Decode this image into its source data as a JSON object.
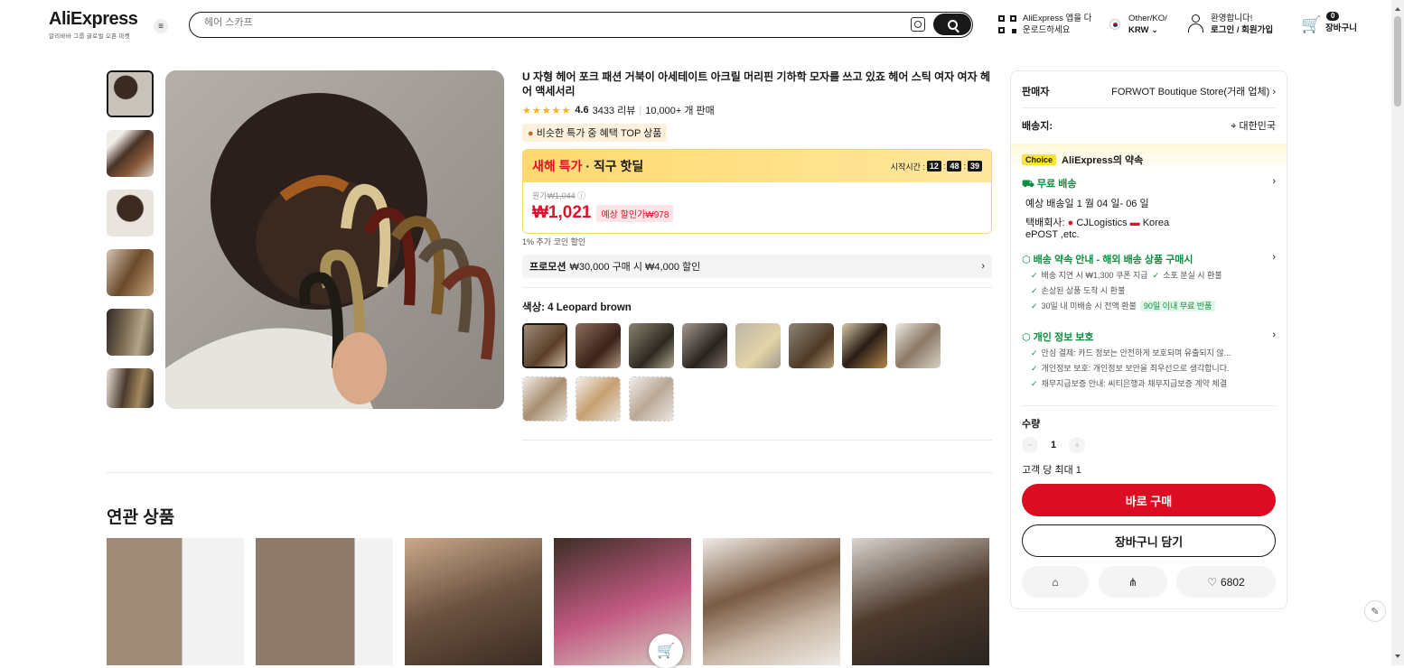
{
  "header": {
    "logo": "AliExpress",
    "logo_sub": "알리바바 그룹 글로벌 오픈 마켓",
    "search_placeholder": "헤어 스카프",
    "app_line1": "AliExpress 앱을 다",
    "app_line2": "운로드하세요",
    "region_line1": "Other/KO/",
    "region_line2": "KRW",
    "user_line1": "환영합니다!",
    "user_line2": "로그인 / 회원가입",
    "cart_count": "0",
    "cart_label": "장바구니"
  },
  "product": {
    "title": "U 자형 헤어 포크 패션 거북이 아세테이트 아크릴 머리핀 기하학 모자를 쓰고 있죠 헤어 스틱 여자 여자 헤어 액세서리",
    "stars": "★★★★★",
    "rating": "4.6",
    "reviews": "3433 리뷰",
    "sold": "10,000+ 개 판매",
    "top_badge": "비슷한 특가 중 혜택 TOP 상품",
    "deal_title": "새해 특가",
    "deal_sub": "· 직구 핫딜",
    "timer_label": "시작시간 :",
    "timer_h": "12",
    "timer_m": "48",
    "timer_s": "39",
    "orig_label": "원가",
    "orig_price": "₩1,044",
    "price": "₩1,021",
    "est_price": "예상 할인가₩978",
    "coin": "1% 추가 코인 할인",
    "promo_label": "프로모션",
    "promo_text": "₩30,000 구매 시 ₩4,000 할인",
    "color_label": "색상: 4 Leopard brown"
  },
  "related": {
    "title": "연관 상품"
  },
  "side": {
    "seller_label": "판매자",
    "seller_name": "FORWOT Boutique Store(거래 업체)",
    "ship_label": "배송지:",
    "ship_to": "대한민국",
    "choice_tag": "Choice",
    "choice_title": "AliExpress의 약속",
    "free_ship": "무료 배송",
    "eta": "예상 배송일 1 월 04 일- 06 일",
    "carrier_label": "택배회사:",
    "carrier1": "CJLogistics",
    "carrier2": "Korea",
    "carrier3": "ePOST ,etc.",
    "promise_title": "배송 약속 안내 - 해외 배송 상품 구매시",
    "p1": "배송 지연 시 ₩1,300 쿠폰 지급",
    "p2": "소포 분실 시 환불",
    "p3": "손상된 상품 도착 시 환불",
    "p4": "30일 내 미배송 시 전액 환불",
    "p4_tag": "90일 이내 무료 반품",
    "privacy_title": "개인 정보 보호",
    "q1": "안심 결제: 카드 정보는 안전하게 보호되며 유출되지 않...",
    "q2": "개인정보 보호: 개인정보 보안을 최우선으로 생각합니다.",
    "q3": "채무지급보증 안내: 씨티은행과 채무지급보증 계약 체결",
    "qty_label": "수량",
    "qty_value": "1",
    "max_qty": "고객 당 최대 1",
    "buy_now": "바로 구매",
    "add_cart": "장바구니 담기",
    "wish_count": "6802"
  }
}
